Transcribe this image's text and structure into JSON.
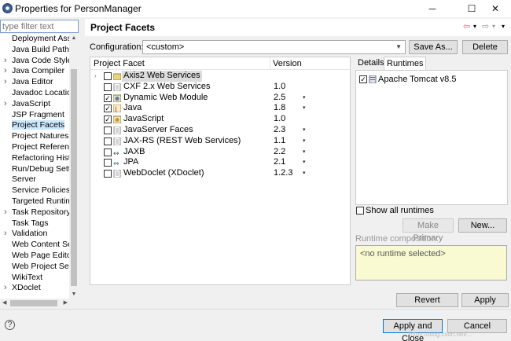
{
  "window": {
    "title": "Properties for PersonManager",
    "minimize": "─",
    "maximize": "☐",
    "close": "✕"
  },
  "filter": {
    "placeholder": "type filter text"
  },
  "sidebar": {
    "items": [
      {
        "label": "Deployment Ass",
        "expandable": false
      },
      {
        "label": "Java Build Path",
        "expandable": false
      },
      {
        "label": "Java Code Style",
        "expandable": true
      },
      {
        "label": "Java Compiler",
        "expandable": true
      },
      {
        "label": "Java Editor",
        "expandable": true
      },
      {
        "label": "Javadoc Locatio",
        "expandable": false
      },
      {
        "label": "JavaScript",
        "expandable": true
      },
      {
        "label": "JSP Fragment",
        "expandable": false
      },
      {
        "label": "Project Facets",
        "expandable": false,
        "selected": true
      },
      {
        "label": "Project Natures",
        "expandable": false
      },
      {
        "label": "Project Referenc",
        "expandable": false
      },
      {
        "label": "Refactoring Hist",
        "expandable": false
      },
      {
        "label": "Run/Debug Setti",
        "expandable": false
      },
      {
        "label": "Server",
        "expandable": false
      },
      {
        "label": "Service Policies",
        "expandable": false
      },
      {
        "label": "Targeted Runtim",
        "expandable": false
      },
      {
        "label": "Task Repository",
        "expandable": true
      },
      {
        "label": "Task Tags",
        "expandable": false
      },
      {
        "label": "Validation",
        "expandable": true
      },
      {
        "label": "Web Content Se",
        "expandable": false
      },
      {
        "label": "Web Page Editor",
        "expandable": false
      },
      {
        "label": "Web Project Set",
        "expandable": false
      },
      {
        "label": "WikiText",
        "expandable": false
      },
      {
        "label": "XDoclet",
        "expandable": true
      }
    ]
  },
  "header": {
    "title": "Project Facets",
    "back": "⇦",
    "forward": "⇨",
    "menu": "▾"
  },
  "configuration": {
    "label": "Configuration:",
    "value": "<custom>",
    "save_as": "Save As...",
    "delete": "Delete"
  },
  "facets": {
    "col_facet": "Project Facet",
    "col_version": "Version",
    "rows": [
      {
        "name": "Axis2 Web Services",
        "version": "",
        "checked": false,
        "expandable": true,
        "selected": true,
        "has_dropdown": false,
        "icon": "folder-icon"
      },
      {
        "name": "CXF 2.x Web Services",
        "version": "1.0",
        "checked": false,
        "has_dropdown": false,
        "icon": "page-icon"
      },
      {
        "name": "Dynamic Web Module",
        "version": "2.5",
        "checked": true,
        "has_dropdown": true,
        "icon": "web-module-icon"
      },
      {
        "name": "Java",
        "version": "1.8",
        "checked": true,
        "has_dropdown": true,
        "icon": "java-icon"
      },
      {
        "name": "JavaScript",
        "version": "1.0",
        "checked": true,
        "has_dropdown": false,
        "icon": "javascript-icon"
      },
      {
        "name": "JavaServer Faces",
        "version": "2.3",
        "checked": false,
        "has_dropdown": true,
        "icon": "page-icon"
      },
      {
        "name": "JAX-RS (REST Web Services)",
        "version": "1.1",
        "checked": false,
        "has_dropdown": true,
        "icon": "page-icon"
      },
      {
        "name": "JAXB",
        "version": "2.2",
        "checked": false,
        "has_dropdown": true,
        "icon": "jaxb-icon"
      },
      {
        "name": "JPA",
        "version": "2.1",
        "checked": false,
        "has_dropdown": true,
        "icon": "jpa-icon"
      },
      {
        "name": "WebDoclet (XDoclet)",
        "version": "1.2.3",
        "checked": false,
        "has_dropdown": true,
        "icon": "page-icon"
      }
    ]
  },
  "tabs": {
    "details": "Details",
    "runtimes": "Runtimes"
  },
  "runtimes": {
    "items": [
      {
        "name": "Apache Tomcat v8.5",
        "checked": true
      }
    ],
    "show_all": "Show all runtimes",
    "make_primary": "Make Primary",
    "new": "New...",
    "composition_label": "Runtime composition:",
    "composition_value": "<no runtime selected>"
  },
  "actions": {
    "revert": "Revert",
    "apply": "Apply",
    "apply_close": "Apply and Close",
    "cancel": "Cancel",
    "help": "?"
  },
  "watermark": "https://blog.csdn.net/..."
}
